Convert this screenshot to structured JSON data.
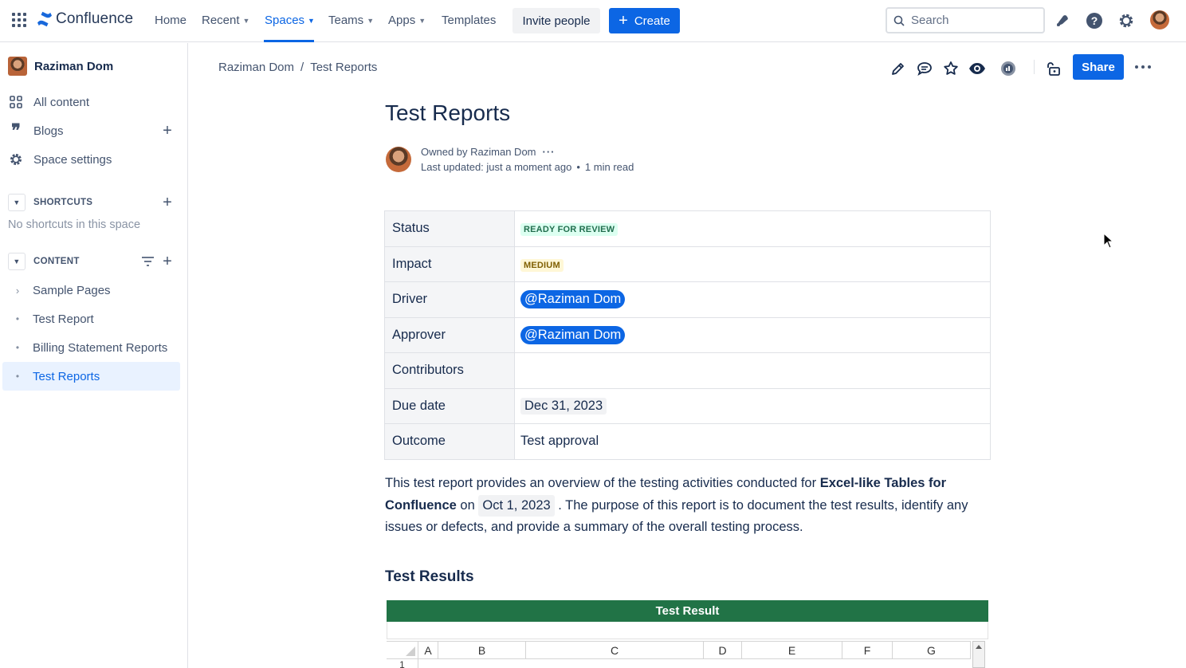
{
  "topnav": {
    "logo_text": "Confluence",
    "items": [
      {
        "label": "Home",
        "dropdown": false
      },
      {
        "label": "Recent",
        "dropdown": true
      },
      {
        "label": "Spaces",
        "dropdown": true,
        "active": true
      },
      {
        "label": "Teams",
        "dropdown": true
      },
      {
        "label": "Apps",
        "dropdown": true
      },
      {
        "label": "Templates",
        "dropdown": false
      }
    ],
    "invite_label": "Invite people",
    "create_label": "Create",
    "search_placeholder": "Search",
    "icons": [
      "notifications-icon",
      "help-icon",
      "settings-icon",
      "profile-avatar"
    ],
    "accent_color": "#0c66e4"
  },
  "sidebar": {
    "space_name": "Raziman Dom",
    "links": [
      {
        "label": "All content",
        "icon": "grid-icon"
      },
      {
        "label": "Blogs",
        "icon": "quote-icon"
      },
      {
        "label": "Space settings",
        "icon": "gear-icon"
      }
    ],
    "shortcuts_heading": "SHORTCUTS",
    "shortcuts_empty": "No shortcuts in this space",
    "content_heading": "CONTENT",
    "tree": [
      {
        "label": "Sample Pages",
        "expandable": true,
        "selected": false
      },
      {
        "label": "Test Report",
        "expandable": false,
        "selected": false
      },
      {
        "label": "Billing Statement Reports",
        "expandable": false,
        "selected": false
      },
      {
        "label": "Test Reports",
        "expandable": false,
        "selected": true
      }
    ]
  },
  "breadcrumb": {
    "items": [
      "Raziman Dom",
      "Test Reports"
    ],
    "separator": "/"
  },
  "page_actions": {
    "icons": [
      "edit-icon",
      "comment-icon",
      "star-icon",
      "watch-icon",
      "analytics-icon",
      "restrictions-icon"
    ],
    "share_label": "Share"
  },
  "page": {
    "title": "Test Reports",
    "owner_text": "Owned by Raziman Dom",
    "updated_text": "Last updated: just a moment ago",
    "read_time": "1 min read",
    "properties": [
      {
        "key": "Status",
        "type": "lozenge",
        "value": "READY FOR REVIEW",
        "color": "green"
      },
      {
        "key": "Impact",
        "type": "lozenge",
        "value": "MEDIUM",
        "color": "yellow"
      },
      {
        "key": "Driver",
        "type": "mention",
        "value": "@Raziman Dom"
      },
      {
        "key": "Approver",
        "type": "mention",
        "value": "@Raziman Dom"
      },
      {
        "key": "Contributors",
        "type": "text",
        "value": ""
      },
      {
        "key": "Due date",
        "type": "date",
        "value": "Dec 31, 2023"
      },
      {
        "key": "Outcome",
        "type": "text",
        "value": "Test approval"
      }
    ],
    "intro": {
      "part1": "This test report provides an overview of the testing activities conducted for ",
      "bold": "Excel-like Tables for Confluence",
      "part2": " on ",
      "date": "Oct 1, 2023",
      "part3": " . The purpose of this report is to document the test results, identify any issues or defects, and provide a summary of the overall testing process."
    },
    "section_heading": "Test Results",
    "sheet": {
      "title": "Test Result",
      "header_color": "#217346",
      "columns": [
        "A",
        "B",
        "C",
        "D",
        "E",
        "F",
        "G"
      ],
      "first_row": "1"
    }
  }
}
